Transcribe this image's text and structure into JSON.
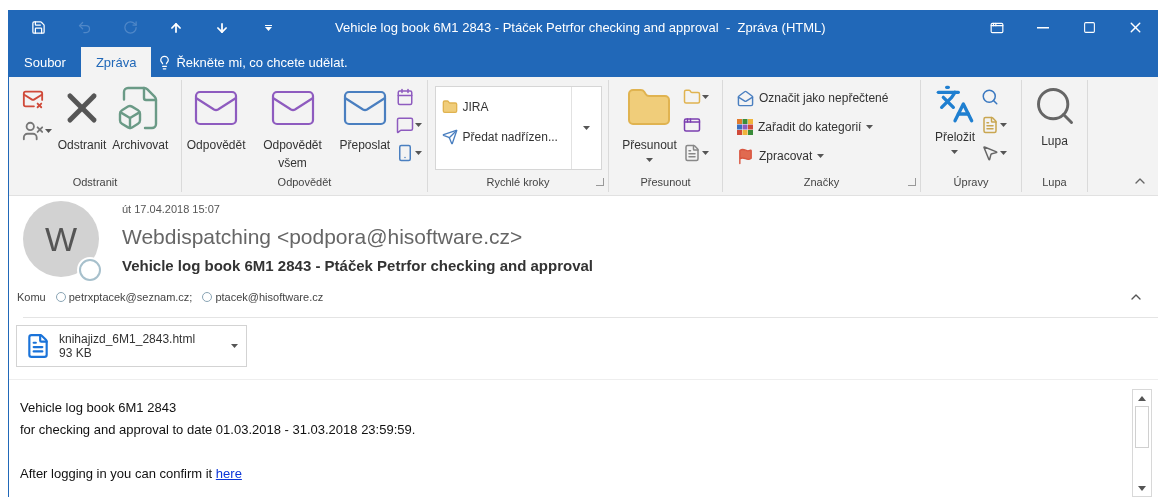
{
  "window": {
    "title": "Vehicle log book 6M1 2843 - Ptáček Petrfor checking and approval  -  Zpráva (HTML)"
  },
  "quick_access": [
    {
      "kind": "save",
      "disabled": false
    },
    {
      "kind": "undo",
      "disabled": true
    },
    {
      "kind": "redo",
      "disabled": true
    },
    {
      "kind": "up",
      "disabled": false
    },
    {
      "kind": "down",
      "disabled": false
    },
    {
      "kind": "customize",
      "disabled": false
    }
  ],
  "tabs": [
    {
      "label": "Soubor",
      "selected": false
    },
    {
      "label": "Zpráva",
      "selected": true
    }
  ],
  "tell_me": "Řekněte mi, co chcete udělat.",
  "ribbon": {
    "groups": [
      {
        "kind": "delete",
        "label": "Odstranit",
        "buttons": [
          "Odstranit",
          "Archivovat"
        ]
      },
      {
        "kind": "respond",
        "label": "Odpovědět",
        "buttons": [
          "Odpovědět",
          "Odpovědět všem",
          "Přeposlat"
        ]
      },
      {
        "kind": "quicksteps",
        "label": "Rychlé kroky",
        "buttons": [
          "JIRA",
          "Předat nadřízen..."
        ]
      },
      {
        "kind": "move",
        "label": "Přesunout",
        "buttons": [
          "Přesunout"
        ]
      },
      {
        "kind": "tags",
        "label": "Značky",
        "buttons": [
          "Označit jako nepřečtené",
          "Zařadit do kategorií",
          "Zpracovat"
        ]
      },
      {
        "kind": "editing",
        "label": "Úpravy",
        "buttons": [
          "Přeložit"
        ]
      },
      {
        "kind": "zoom",
        "label": "Lupa",
        "buttons": [
          "Lupa"
        ]
      }
    ]
  },
  "message": {
    "date": "út 17.04.2018 15:07",
    "avatar_letter": "W",
    "sender": "Webdispatching <podpora@hisoftware.cz>",
    "subject": "Vehicle log book 6M1 2843 - Ptáček Petrfor checking and approval",
    "to_label": "Komu",
    "recipients": [
      "petrxptacek@seznam.cz;",
      "ptacek@hisoftware.cz"
    ],
    "attachment": {
      "name": "knihajizd_6M1_2843.html",
      "size": "93 KB"
    },
    "body": {
      "lines": [
        "Vehicle log book 6M1 2843",
        "for checking and approval to date 01.03.2018 - 31.03.2018 23:59:59."
      ],
      "confirm": {
        "text": "After logging in you can confirm it",
        "link": "here"
      }
    }
  }
}
